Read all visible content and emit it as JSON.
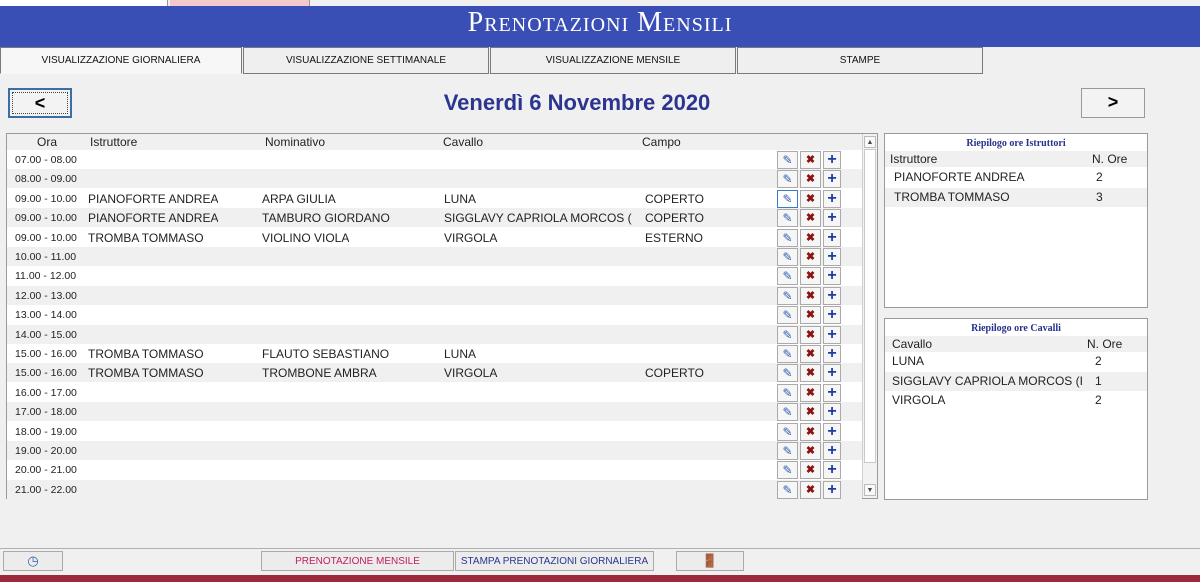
{
  "window": {
    "title": "Prenotazioni Mensili"
  },
  "tabs": [
    {
      "label": "VISUALIZZAZIONE GIORNALIERA"
    },
    {
      "label": "VISUALIZZAZIONE SETTIMANALE"
    },
    {
      "label": "VISUALIZZAZIONE MENSILE"
    },
    {
      "label": "STAMPE"
    }
  ],
  "nav": {
    "prev_label": "<",
    "next_label": ">",
    "date": "Venerdì  6  Novembre  2020"
  },
  "grid": {
    "columns": {
      "ora": "Ora",
      "istruttore": "Istruttore",
      "nominativo": "Nominativo",
      "cavallo": "Cavallo",
      "campo": "Campo"
    },
    "rows": [
      {
        "ora": "07.00 - 08.00",
        "istruttore": "",
        "nominativo": "",
        "cavallo": "",
        "campo": ""
      },
      {
        "ora": "08.00 - 09.00",
        "istruttore": "",
        "nominativo": "",
        "cavallo": "",
        "campo": ""
      },
      {
        "ora": "09.00 - 10.00",
        "istruttore": "PIANOFORTE ANDREA",
        "nominativo": "ARPA GIULIA",
        "cavallo": "LUNA",
        "campo": "COPERTO"
      },
      {
        "ora": "09.00 - 10.00",
        "istruttore": "PIANOFORTE ANDREA",
        "nominativo": "TAMBURO GIORDANO",
        "cavallo": "SIGGLAVY CAPRIOLA MORCOS (",
        "campo": "COPERTO"
      },
      {
        "ora": "09.00 - 10.00",
        "istruttore": "TROMBA TOMMASO",
        "nominativo": "VIOLINO VIOLA",
        "cavallo": "VIRGOLA",
        "campo": "ESTERNO"
      },
      {
        "ora": "10.00 - 11.00",
        "istruttore": "",
        "nominativo": "",
        "cavallo": "",
        "campo": ""
      },
      {
        "ora": "11.00 - 12.00",
        "istruttore": "",
        "nominativo": "",
        "cavallo": "",
        "campo": ""
      },
      {
        "ora": "12.00 - 13.00",
        "istruttore": "",
        "nominativo": "",
        "cavallo": "",
        "campo": ""
      },
      {
        "ora": "13.00 - 14.00",
        "istruttore": "",
        "nominativo": "",
        "cavallo": "",
        "campo": ""
      },
      {
        "ora": "14.00 - 15.00",
        "istruttore": "",
        "nominativo": "",
        "cavallo": "",
        "campo": ""
      },
      {
        "ora": "15.00 - 16.00",
        "istruttore": "TROMBA TOMMASO",
        "nominativo": "FLAUTO SEBASTIANO",
        "cavallo": "LUNA",
        "campo": ""
      },
      {
        "ora": "15.00 - 16.00",
        "istruttore": "TROMBA TOMMASO",
        "nominativo": "TROMBONE AMBRA",
        "cavallo": "VIRGOLA",
        "campo": "COPERTO"
      },
      {
        "ora": "16.00 - 17.00",
        "istruttore": "",
        "nominativo": "",
        "cavallo": "",
        "campo": ""
      },
      {
        "ora": "17.00 - 18.00",
        "istruttore": "",
        "nominativo": "",
        "cavallo": "",
        "campo": ""
      },
      {
        "ora": "18.00 - 19.00",
        "istruttore": "",
        "nominativo": "",
        "cavallo": "",
        "campo": ""
      },
      {
        "ora": "19.00 - 20.00",
        "istruttore": "",
        "nominativo": "",
        "cavallo": "",
        "campo": ""
      },
      {
        "ora": "20.00 - 21.00",
        "istruttore": "",
        "nominativo": "",
        "cavallo": "",
        "campo": ""
      },
      {
        "ora": "21.00 - 22.00",
        "istruttore": "",
        "nominativo": "",
        "cavallo": "",
        "campo": ""
      }
    ],
    "actions": {
      "edit": "pencil-icon",
      "delete": "delete-x-icon",
      "add": "plus-icon"
    }
  },
  "riepilogo_istruttori": {
    "title": "Riepilogo ore Istruttori",
    "col_name": "Istruttore",
    "col_hours": "N. Ore",
    "rows": [
      {
        "name": "PIANOFORTE ANDREA",
        "hours": "2"
      },
      {
        "name": "TROMBA TOMMASO",
        "hours": "3"
      }
    ]
  },
  "riepilogo_cavalli": {
    "title": "Riepilogo ore Cavalli",
    "col_name": "Cavallo",
    "col_hours": "N. Ore",
    "rows": [
      {
        "name": "LUNA",
        "hours": "2"
      },
      {
        "name": "SIGGLAVY CAPRIOLA MORCOS (I",
        "hours": "1"
      },
      {
        "name": "VIRGOLA",
        "hours": "2"
      }
    ]
  },
  "statusbar": {
    "clock_icon": "clock-icon",
    "btn_prenotazione": "PRENOTAZIONE MENSILE",
    "btn_stampa": "STAMPA PRENOTAZIONI GIORNALIERA",
    "exit_icon": "exit-door-icon"
  },
  "colors": {
    "title_bar": "#3a4fb5",
    "date_text": "#2b3590",
    "bottom_line": "#9c2a3c",
    "prenotazione_text": "#c0205a",
    "stampa_text": "#2b3590"
  }
}
